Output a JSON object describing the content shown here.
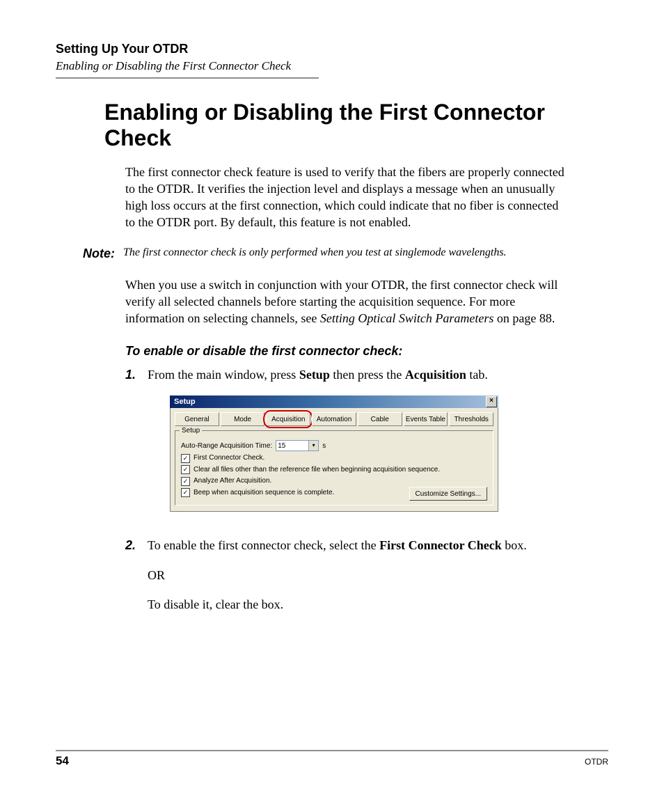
{
  "header": {
    "chapter": "Setting Up Your OTDR",
    "section": "Enabling or Disabling the First Connector Check"
  },
  "title": "Enabling or Disabling the First Connector Check",
  "paragraphs": {
    "intro": "The first connector check feature is used to verify that the fibers are properly connected to the OTDR. It verifies the injection level and displays a message when an unusually high loss occurs at the first connection, which could indicate that no fiber is connected to the OTDR port. By default, this feature is not enabled.",
    "switch_a": "When you use a switch in conjunction with your OTDR, the first connector check will verify all selected channels before starting the acquisition sequence. For more information on selecting channels, see ",
    "switch_ref": "Setting Optical Switch Parameters",
    "switch_b": " on page 88."
  },
  "note": {
    "label": "Note:",
    "text": "The first connector check is only performed when you test at singlemode wavelengths."
  },
  "procedure": {
    "heading": "To enable or disable the first connector check:",
    "step1_a": "From the main window, press ",
    "step1_setup": "Setup",
    "step1_b": " then press the ",
    "step1_acq": "Acquisition",
    "step1_c": " tab.",
    "step2_a": "To enable the first connector check, select the ",
    "step2_bold": "First Connector Check",
    "step2_b": " box.",
    "step2_or": "OR",
    "step2_c": "To disable it, clear the box."
  },
  "dialog": {
    "title": "Setup",
    "close": "×",
    "tabs": [
      "General",
      "Mode",
      "Acquisition",
      "Automation",
      "Cable",
      "Events Table",
      "Thresholds"
    ],
    "group_label": "Setup",
    "auto_range_label": "Auto-Range Acquisition Time:",
    "auto_range_value": "15",
    "auto_range_unit": "s",
    "first_conn": "First Connector Check.",
    "clear_files": "Clear all files other than the reference file when beginning acquisition sequence.",
    "analyze": "Analyze After Acquisition.",
    "beep": "Beep when acquisition sequence is complete.",
    "customize": "Customize Settings..."
  },
  "footer": {
    "page": "54",
    "product": "OTDR"
  }
}
